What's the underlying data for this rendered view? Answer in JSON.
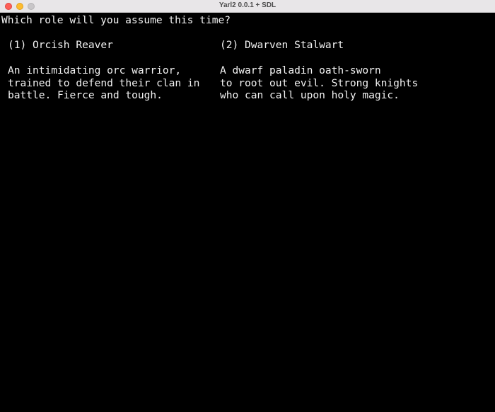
{
  "window": {
    "title": "Yarl2 0.0.1 + SDL",
    "controls": [
      "close",
      "minimize",
      "maximize"
    ]
  },
  "terminal": {
    "prompt": "Which role will you assume this time?",
    "options": [
      {
        "key": "1",
        "heading": "(1) Orcish Reaver",
        "name": "Orcish Reaver",
        "description": [
          "An intimidating orc warrior,",
          "trained to defend their clan in",
          "battle. Fierce and tough."
        ]
      },
      {
        "key": "2",
        "heading": "(2) Dwarven Stalwart",
        "name": "Dwarven Stalwart",
        "description": [
          "A dwarf paladin oath-sworn",
          "to root out evil. Strong knights",
          "who can call upon holy magic."
        ]
      }
    ]
  },
  "colors": {
    "background": "#000000",
    "text": "#f2f2f2",
    "titlebar": "#e8e6e8"
  }
}
